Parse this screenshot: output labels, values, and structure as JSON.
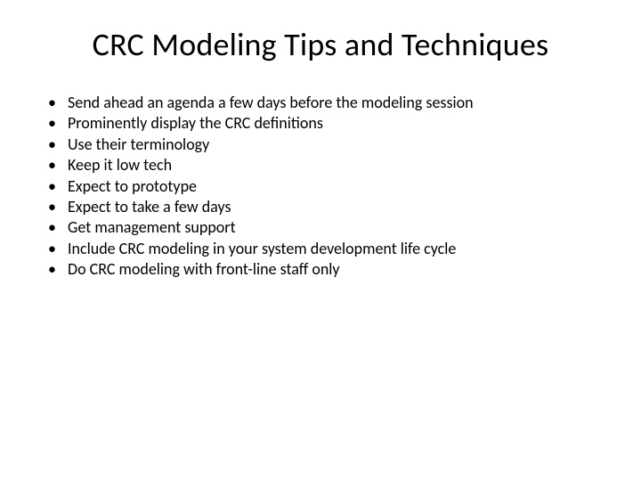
{
  "slide": {
    "title": "CRC Modeling Tips and Techniques",
    "bullets": [
      "Send ahead an agenda a few days before the modeling session",
      "Prominently display the CRC definitions",
      "Use their terminology",
      "Keep it low tech",
      "Expect to prototype",
      "Expect to take a few days",
      "Get management support",
      "Include CRC modeling in your system development life cycle",
      "Do CRC modeling with front-line staff only"
    ]
  }
}
